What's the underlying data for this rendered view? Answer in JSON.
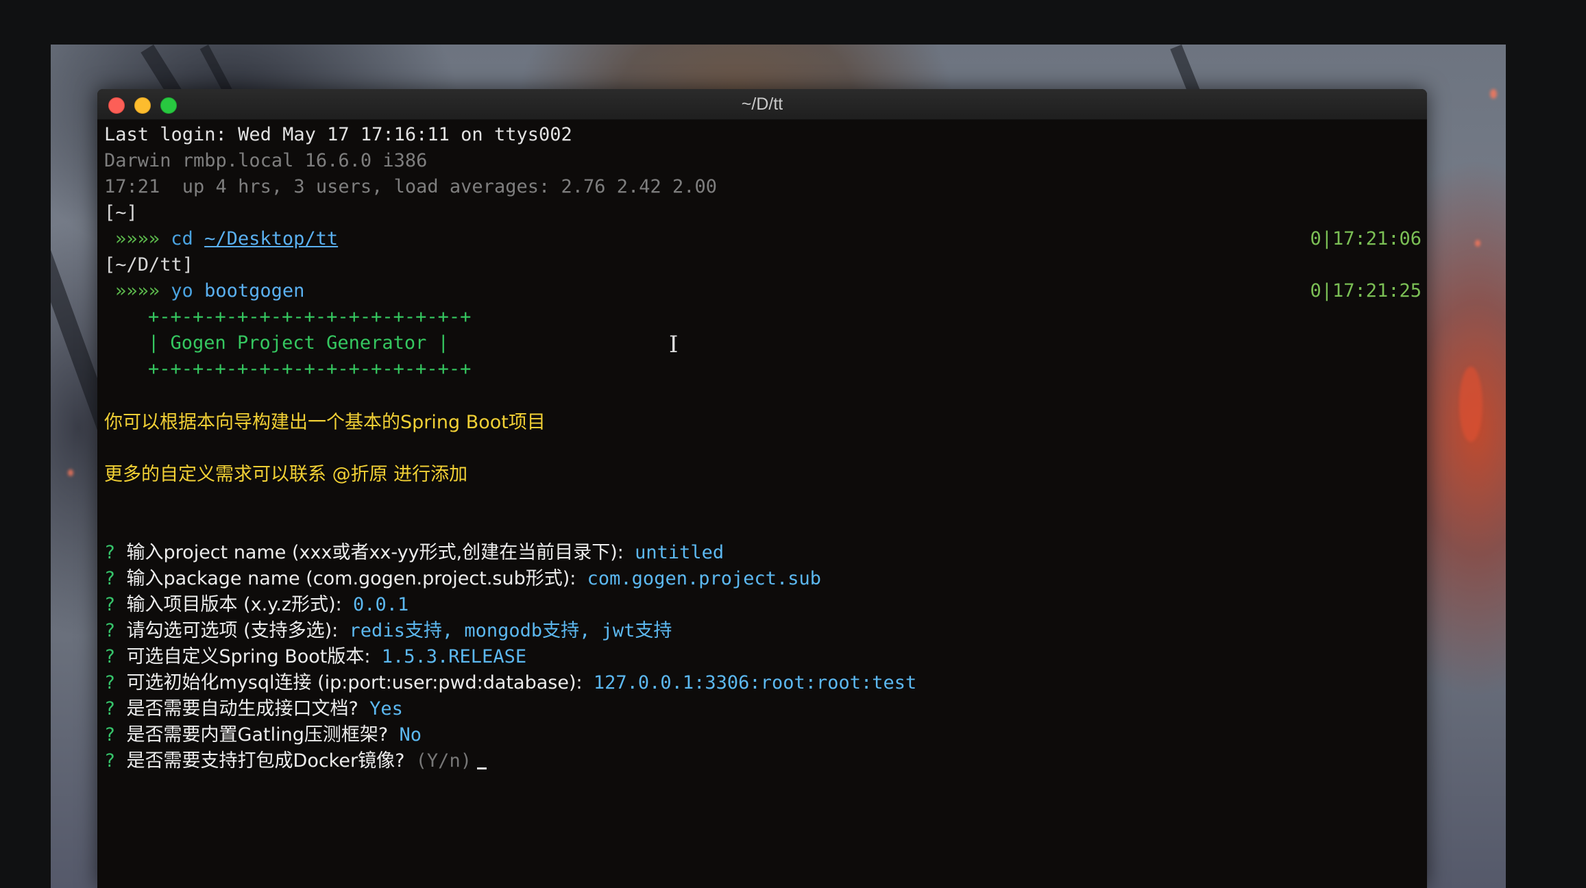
{
  "window": {
    "title": "~/D/tt"
  },
  "colors": {
    "close": "#fc5f57",
    "minimize": "#fdbc2e",
    "maximize": "#28c840",
    "background": "#0d0b0a"
  },
  "icons": {
    "text_cursor": "ibeam-cursor-icon"
  },
  "terminal": {
    "last_login": "Last login: Wed May 17 17:16:11 on ttys002",
    "darwin": "Darwin rmbp.local 16.6.0 i386",
    "uptime": "17:21  up 4 hrs, 3 users, load averages: 2.76 2.42 2.00",
    "prompt1": "[~]",
    "arrows": "»»»»",
    "cmd1": "cd",
    "cmd1_arg": "~/Desktop/tt",
    "time1": "0|17:21:06",
    "prompt2": "[~/D/tt]",
    "cmd2": "yo",
    "cmd2_arg": "bootgogen",
    "time2": "0|17:21:25",
    "banner_top": "+-+-+-+-+-+-+-+-+-+-+-+-+-+-+",
    "banner_mid": "| Gogen Project Generator |",
    "banner_bottom": "+-+-+-+-+-+-+-+-+-+-+-+-+-+-+",
    "intro1": "你可以根据本向导构建出一个基本的Spring Boot项目",
    "intro2": "更多的自定义需求可以联系 @折原 进行添加",
    "questions": [
      {
        "mark": "?",
        "text": "输入project name (xxx或者xx-yy形式,创建在当前目录下):",
        "answer": "untitled"
      },
      {
        "mark": "?",
        "text": "输入package name (com.gogen.project.sub形式):",
        "answer": "com.gogen.project.sub"
      },
      {
        "mark": "?",
        "text": "输入项目版本 (x.y.z形式):",
        "answer": "0.0.1"
      },
      {
        "mark": "?",
        "text": "请勾选可选项 (支持多选):",
        "answer": "redis支持, mongodb支持, jwt支持"
      },
      {
        "mark": "?",
        "text": "可选自定义Spring Boot版本:",
        "answer": "1.5.3.RELEASE"
      },
      {
        "mark": "?",
        "text": "可选初始化mysql连接 (ip:port:user:pwd:database):",
        "answer": "127.0.0.1:3306:root:root:test"
      },
      {
        "mark": "?",
        "text": "是否需要自动生成接口文档?",
        "answer": "Yes"
      },
      {
        "mark": "?",
        "text": "是否需要内置Gatling压测框架?",
        "answer": "No"
      },
      {
        "mark": "?",
        "text": "是否需要支持打包成Docker镜像?",
        "answer": "(Y/n)"
      }
    ]
  }
}
